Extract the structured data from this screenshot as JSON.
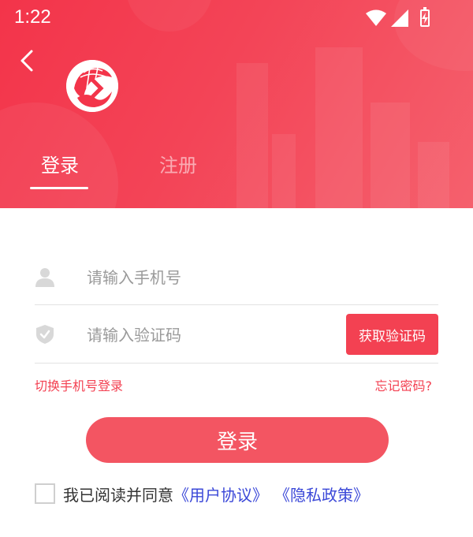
{
  "status_bar": {
    "time": "1:22",
    "icons": [
      "wifi-icon",
      "signal-icon",
      "battery-charging-icon"
    ]
  },
  "header": {
    "back_icon": "chevron-left-icon",
    "logo": "app-logo-globe",
    "tabs": [
      {
        "label": "登录",
        "active": true
      },
      {
        "label": "注册",
        "active": false
      }
    ],
    "accent_color": "#f34152"
  },
  "form": {
    "phone": {
      "placeholder": "请输入手机号",
      "value": "",
      "icon": "user-icon"
    },
    "code": {
      "placeholder": "请输入验证码",
      "value": "",
      "icon": "shield-icon"
    },
    "get_code_label": "获取验证码",
    "switch_login_label": "切换手机号登录",
    "forgot_password_label": "忘记密码?",
    "login_button_label": "登录"
  },
  "agreement": {
    "checked": false,
    "prefix": "我已阅读并同意",
    "user_agreement": "《用户协议》",
    "privacy_policy": "《隐私政策》"
  }
}
